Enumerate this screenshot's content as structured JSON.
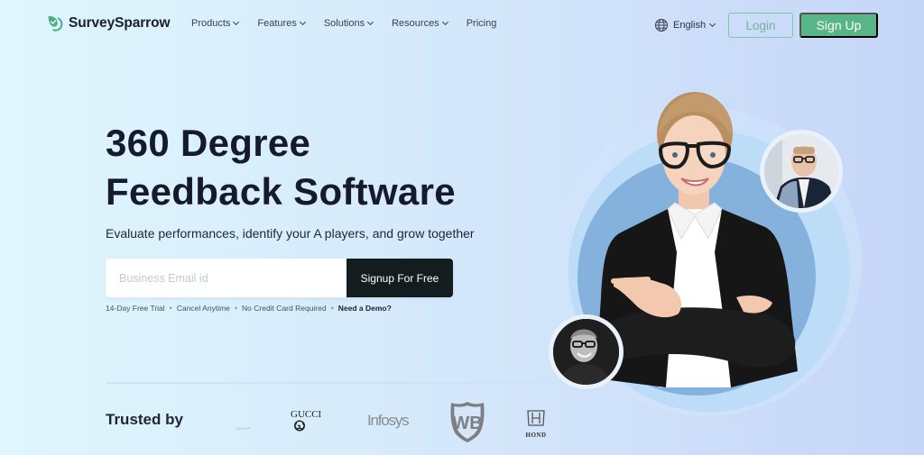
{
  "brand": {
    "name": "SurveySparrow",
    "logo_icon": "sparrow-leaf-icon",
    "accent_color": "#58b588",
    "dark_color": "#141c1f"
  },
  "nav": {
    "items": [
      {
        "label": "Products",
        "has_dropdown": true
      },
      {
        "label": "Features",
        "has_dropdown": true
      },
      {
        "label": "Solutions",
        "has_dropdown": true
      },
      {
        "label": "Resources",
        "has_dropdown": true
      },
      {
        "label": "Pricing",
        "has_dropdown": false
      }
    ],
    "language": {
      "icon": "globe-icon",
      "label": "English"
    },
    "login_label": "Login",
    "signup_label": "Sign Up"
  },
  "hero": {
    "title_line1": "360 Degree",
    "title_line2": "Feedback Software",
    "subtitle": "Evaluate performances, identify your A players, and grow together",
    "email_placeholder": "Business Email id",
    "email_value": "",
    "cta_label": "Signup For Free",
    "perks": [
      "14-Day Free Trial",
      "Cancel Anytime",
      "No Credit Card Required"
    ],
    "demo_link": "Need a Demo?",
    "separator": "•"
  },
  "trusted": {
    "label": "Trusted by",
    "logos": [
      {
        "name": "group-logo",
        "text": "GROUP"
      },
      {
        "name": "gucci-logo",
        "text": "GUCCI"
      },
      {
        "name": "infosys-logo",
        "text": "Infosys"
      },
      {
        "name": "warner-bros-logo",
        "text": "WB"
      },
      {
        "name": "honda-logo",
        "text": "HOND"
      }
    ]
  },
  "visual": {
    "main_image": "businesswoman-pointing-photo",
    "avatar_top": "man-in-suit-avatar",
    "avatar_bottom": "smiling-man-bw-avatar"
  }
}
